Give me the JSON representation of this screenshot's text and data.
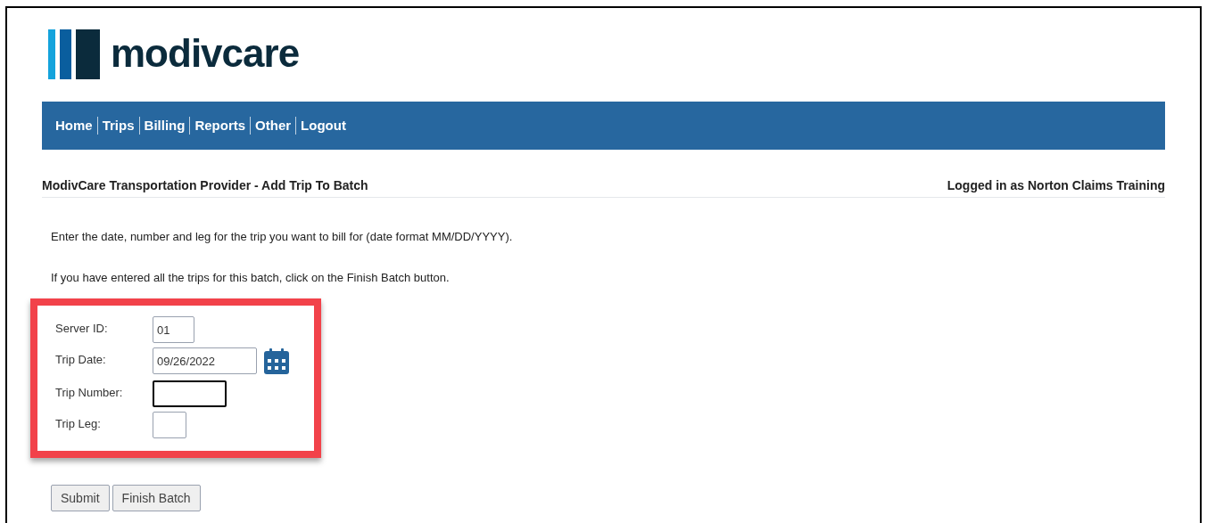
{
  "logo": {
    "text": "modivcare"
  },
  "nav": [
    {
      "label": "Home"
    },
    {
      "label": "Trips"
    },
    {
      "label": "Billing"
    },
    {
      "label": "Reports"
    },
    {
      "label": "Other"
    },
    {
      "label": "Logout"
    }
  ],
  "page_title": "ModivCare Transportation Provider - Add Trip To Batch",
  "user": "Logged in as Norton Claims Training",
  "instructions": [
    "Enter the date, number and leg for the trip you want to bill for (date format MM/DD/YYYY).",
    "If you have entered all the trips for this batch, click on the Finish Batch button."
  ],
  "fields": [
    {
      "label": "Server ID:",
      "value": "01",
      "kind": "short",
      "focused": false
    },
    {
      "label": "Trip Date:",
      "value": "09/26/2022",
      "kind": "date",
      "focused": false
    },
    {
      "label": "Trip Number:",
      "kind": "text",
      "focused": true
    },
    {
      "label": "Trip Leg:",
      "kind": "tiny",
      "focused": false
    }
  ],
  "buttons": [
    "Submit",
    "Finish Batch"
  ]
}
